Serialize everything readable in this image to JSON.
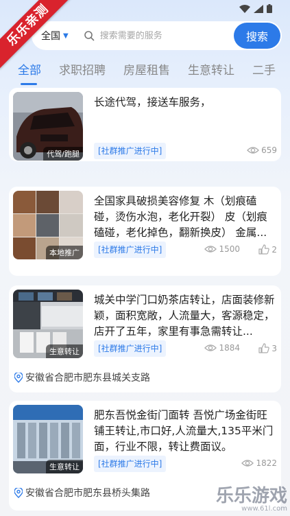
{
  "ribbon": "乐乐亲测",
  "search": {
    "city": "全国",
    "placeholder": "搜索需要的服务",
    "button": "搜索"
  },
  "tabs": [
    "全部",
    "求职招聘",
    "房屋租售",
    "生意转让",
    "二手"
  ],
  "colors": {
    "accent": "#2c7ae8",
    "ribbon": "#d9232d"
  },
  "cards": [
    {
      "title": "长途代驾，接送车服务，",
      "tag": "代驾/跑腿",
      "promo": "[社群推广进行中]",
      "views": "659"
    },
    {
      "title": "全国家具破损美容修复 木（划痕磕碰，烫伤水泡，老化开裂） 皮（划痕磕碰，老化掉色，翻新换皮） 金属...",
      "tag": "本地推广",
      "promo": "[社群推广进行中]",
      "views": "1500",
      "likes": "2"
    },
    {
      "title": "城关中学门口奶茶店转让，店面装修新颖，面积宽敞，人流量大，客源稳定，店开了五年，家里有事急需转让...",
      "tag": "生意转让",
      "promo": "[社群推广进行中]",
      "views": "1884",
      "likes": "3",
      "location": "安徽省合肥市肥东县城关支路"
    },
    {
      "title": "肥东吾悦金街门面转 吾悦广场金街旺铺王转让,市口好,人流量大,135平米门面，行业不限，转让费面议。",
      "tag": "生意转让",
      "promo": "[社群推广进行中]",
      "views": "1822",
      "location": "安徽省合肥市肥东县桥头集路"
    }
  ],
  "watermark": {
    "main": "乐乐游戏",
    "sub": "www.61l.com"
  }
}
